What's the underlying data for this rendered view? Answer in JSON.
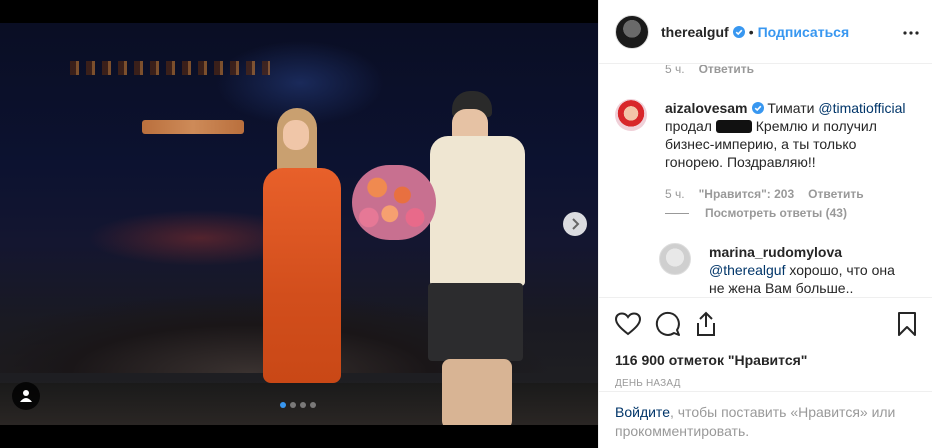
{
  "header": {
    "username": "therealguf",
    "follow_label": "Подписаться",
    "separator": "•",
    "more_icon": "ellipsis-icon"
  },
  "comments": {
    "prev_meta": {
      "time": "5 ч.",
      "reply": "Ответить"
    },
    "main": {
      "username": "aizalovesam",
      "text_before": "Тимати",
      "mention": "@timatiofficial",
      "text_line2_a": "продал",
      "text_line2_b": "Кремлю и получил",
      "text_rest": "бизнес-империю, а ты только гонорею. Поздравляю!!",
      "time": "5 ч.",
      "likes": "\"Нравится\": 203",
      "reply": "Ответить"
    },
    "view_replies": "Посмотреть ответы (43)",
    "reply": {
      "username": "marina_rudomylova",
      "mention": "@therealguf",
      "text": "хорошо, что она не жена Вам больше.."
    }
  },
  "actions": {
    "like_icon": "heart-icon",
    "comment_icon": "comment-icon",
    "share_icon": "share-icon",
    "save_icon": "bookmark-icon",
    "likes_count": "116 900 отметок \"Нравится\"",
    "posted": "ДЕНЬ НАЗАД"
  },
  "login": {
    "link": "Войдите",
    "text": ", чтобы поставить «Нравится» или прокомментировать."
  },
  "colors": {
    "link_blue": "#3897f0",
    "dark_link": "#003569",
    "muted": "#999999"
  }
}
